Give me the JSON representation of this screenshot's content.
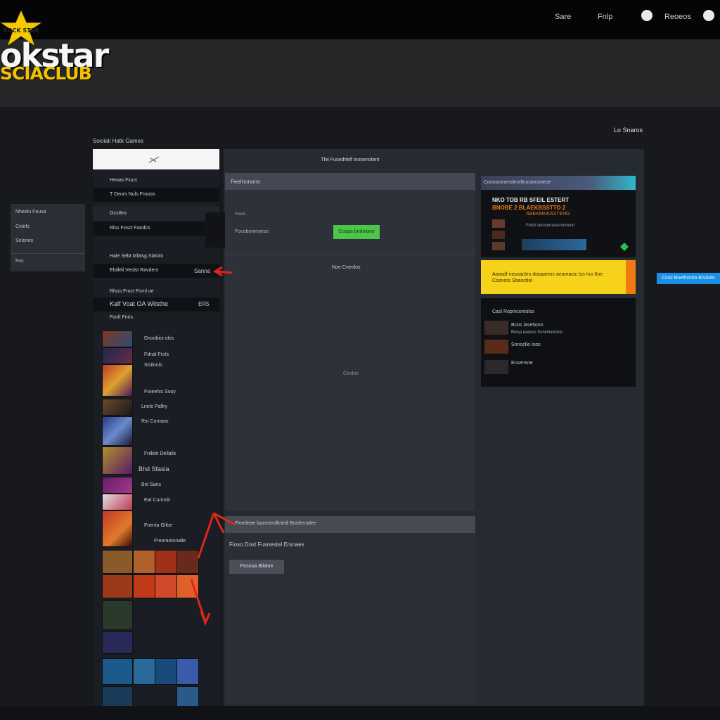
{
  "header": {
    "links": [
      "Sare",
      "Fnlp",
      "Reoeos"
    ],
    "logo": {
      "badge": "ROCK STAR",
      "main": "okstar",
      "sub": "SCIACLUB"
    }
  },
  "page": {
    "section_title": "Sociiali Hatk Games",
    "right_title": "Lo Snaros",
    "right_chip": "Lo",
    "center_tab_title": "Tlei Fusedrtelf inonenotent"
  },
  "left_panel": {
    "items": [
      "Nheelu Fousa",
      "Cnlefs",
      "Selenes",
      "Fos"
    ]
  },
  "left_col": {
    "search_icon": "search-icon",
    "nav": [
      {
        "label": "Heoas Fiucs",
        "selected": false
      },
      {
        "label": "T Deurs Nuls Frouos",
        "selected": true
      },
      {
        "label": "Ocstleo",
        "selected": false
      },
      {
        "label": "Rlss Fosct Fandcs",
        "selected": false
      },
      {
        "label": "Hale Sebt Mlalsg Slatolo",
        "selected": false
      },
      {
        "label": "Elolleli Veolst Ravders",
        "selected": false
      },
      {
        "label": "Rlsss Froct Fnrnl oe",
        "selected": false
      },
      {
        "label": "Kalf Voat OA Wilsthe",
        "selected": false
      },
      {
        "label": "Fonlt Fnris",
        "selected": false
      }
    ],
    "nav_side": "Sanna",
    "nav_right": "ER5",
    "games": [
      "Dnoobioi olos",
      "Fdnal Frols",
      "Sisilnnis",
      "Froeehis Sosy",
      "Lnelo Paflry",
      "Rst Cumaos",
      "Fnlleln Dellalls",
      "Bhd Sfasia",
      "Bnl Sans",
      "Eat Cunnob",
      "Fnenla Gifoe",
      "Freorantonalle"
    ]
  },
  "center": {
    "header": "Feelnonons",
    "row1": "Fwod",
    "row2": "Focobomnoess",
    "green_button": "Coqaa bedolono",
    "sub_label": "Noe Cneolos",
    "placeholder": "Clodos",
    "lower_header": "Floreleae faoncerolleiedi Bosfrenalee",
    "lower_text": "Fioso Dost Fusnestel Ersnaes",
    "gray_button": "Posnoa Bilalne"
  },
  "right": {
    "promo_header": "Conosmnensleorllcostocnneoe",
    "promo_title": "NKO TOB   RB SFEIL   ESTERT",
    "promo_lines": [
      "BNOBE 2   BLAEKBSSTTO 2",
      "SBEKMKEASTENG",
      "Feiisl selosemosennmenn"
    ],
    "yellow_text": "Aoasdf nosoacles dospannic aeamacic tss tno 6oe Cosnors Sbeoctiol",
    "blue_button": "Cinsi Bnelfnimia Bnoloto",
    "news_title": "Casl Ropnicontolss",
    "news_items": [
      "Bcos lasetionn",
      "Biosp eaesss Scnimlanctos",
      "Snnoclle loos",
      "Ecsensne"
    ]
  },
  "colors": {
    "accent_green": "#4cc54a",
    "accent_yellow": "#f7d21a",
    "accent_orange": "#f07a12",
    "accent_blue": "#1a8fe6",
    "arrow_red": "#e0251c"
  }
}
